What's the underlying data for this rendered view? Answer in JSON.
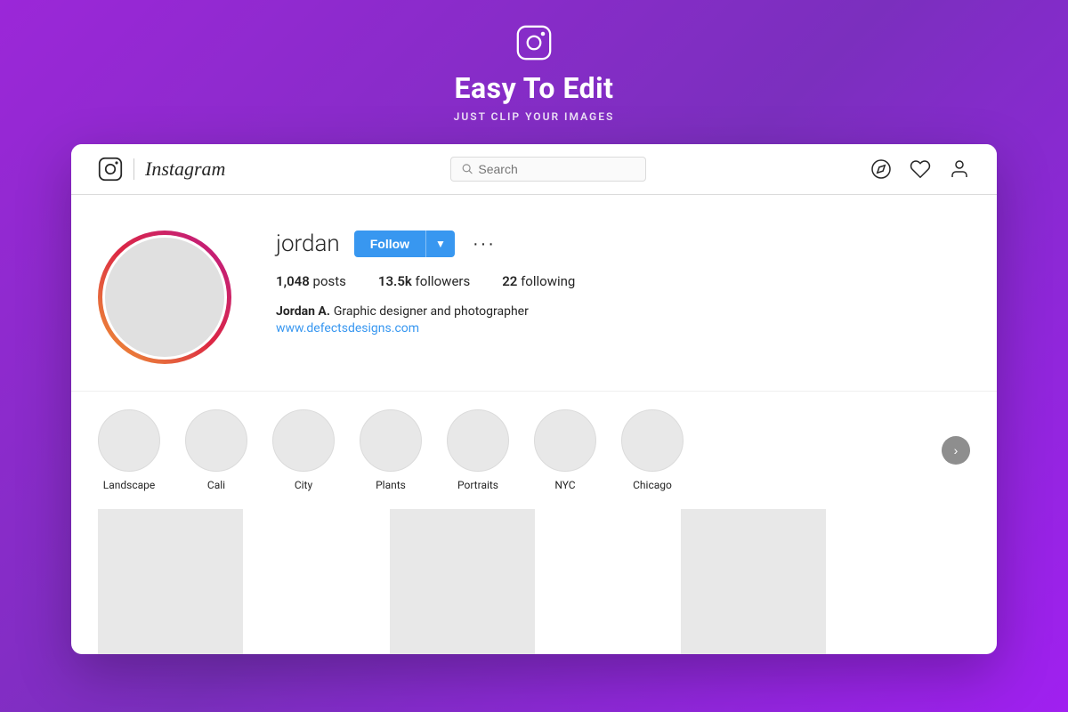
{
  "header": {
    "title": "Easy To Edit",
    "subtitle": "JUST CLIP YOUR IMAGES"
  },
  "navbar": {
    "logo_text": "Instagram",
    "search_placeholder": "Search",
    "icons": [
      "compass-icon",
      "heart-icon",
      "user-icon"
    ]
  },
  "profile": {
    "username": "jordan",
    "follow_label": "Follow",
    "dropdown_arrow": "▼",
    "more_options": "···",
    "stats": {
      "posts_count": "1,048",
      "posts_label": "posts",
      "followers_count": "13.5k",
      "followers_label": "followers",
      "following_count": "22",
      "following_label": "following"
    },
    "bio_name": "Jordan A.",
    "bio_text": "Graphic designer and photographer",
    "bio_link": "www.defectsdesigns.com"
  },
  "highlights": [
    {
      "label": "Landscape"
    },
    {
      "label": "Cali"
    },
    {
      "label": "City"
    },
    {
      "label": "Plants"
    },
    {
      "label": "Portraits"
    },
    {
      "label": "NYC"
    },
    {
      "label": "Chicago"
    }
  ],
  "next_button_label": "›",
  "posts": [
    {
      "id": 1
    },
    {
      "id": 2
    },
    {
      "id": 3
    }
  ]
}
